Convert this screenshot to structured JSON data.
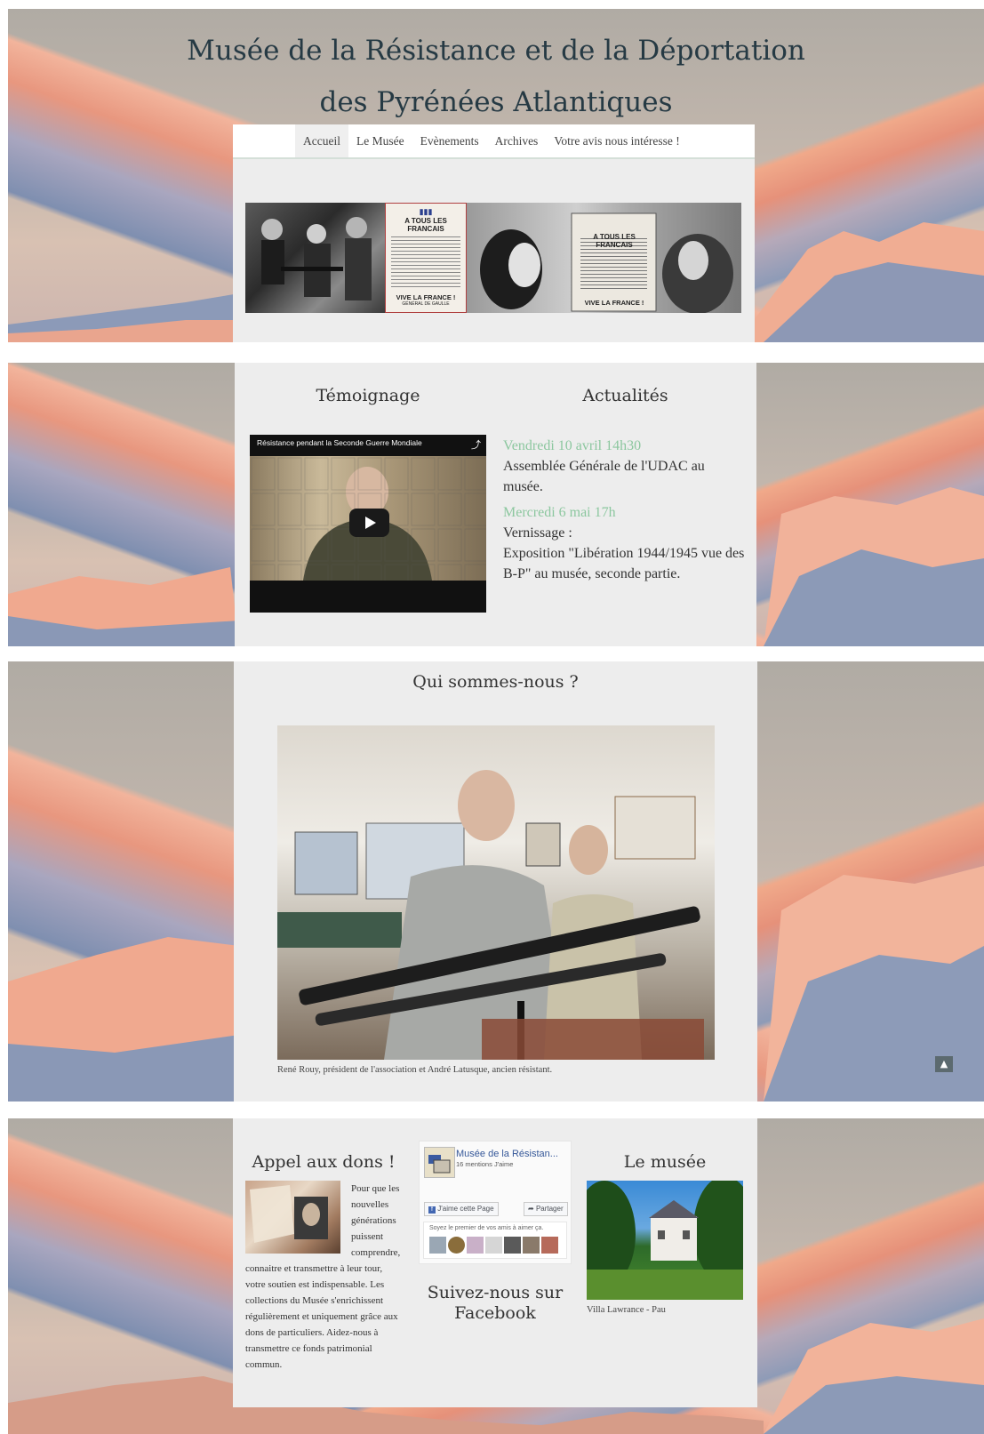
{
  "site": {
    "title_line1": "Musée de la Résistance et de la Déportation",
    "title_line2": "des Pyrénées Atlantiques"
  },
  "nav": {
    "items": [
      {
        "label": "Accueil",
        "active": true
      },
      {
        "label": "Le Musée",
        "active": false
      },
      {
        "label": "Evènements",
        "active": false
      },
      {
        "label": "Archives",
        "active": false
      },
      {
        "label": "Votre avis nous intéresse !",
        "active": false
      }
    ]
  },
  "banner": {
    "poster_heading": "A TOUS LES FRANCAIS",
    "poster_footer": "VIVE LA FRANCE !",
    "poster_signature": "GÉNÉRAL DE GAULLE"
  },
  "temoignage": {
    "heading": "Témoignage",
    "video_title": "Résistance pendant la Seconde Guerre Mondiale"
  },
  "actualites": {
    "heading": "Actualités",
    "items": [
      {
        "date": "Vendredi 10 avril 14h30",
        "text": "Assemblée Générale de l'UDAC au musée."
      },
      {
        "date": "Mercredi 6 mai 17h",
        "text": "Vernissage :",
        "text2": "Exposition \"Libération 1944/1945 vue des B-P\" au musée, seconde partie."
      }
    ]
  },
  "about": {
    "heading": "Qui sommes-nous ?",
    "caption": "René Rouy, président de l'association et André Latusque, ancien résistant."
  },
  "dons": {
    "heading": "Appel aux dons !",
    "text": "Pour que les nouvelles générations puissent comprendre, connaitre et transmettre à leur tour, votre soutien est indispensable. Les collections du Musée s'enrichissent régulièrement et uniquement grâce aux dons de particuliers. Aidez-nous à transmettre ce fonds patrimonial commun."
  },
  "facebook": {
    "page_name": "Musée de la Résistan...",
    "likes": "16 mentions J'aime",
    "like_button": "J'aime cette Page",
    "share_button": "Partager",
    "friends_text": "Soyez le premier de vos amis à aimer ça.",
    "heading": "Suivez-nous sur Facebook"
  },
  "musee": {
    "heading": "Le musée",
    "caption": "Villa Lawrance - Pau"
  },
  "icons": {
    "to_top": "chevron-up-icon",
    "share": "share-icon",
    "play": "play-icon"
  },
  "colors": {
    "title": "#263a44",
    "news_date": "#8cc79f",
    "panel": "#ededed"
  }
}
